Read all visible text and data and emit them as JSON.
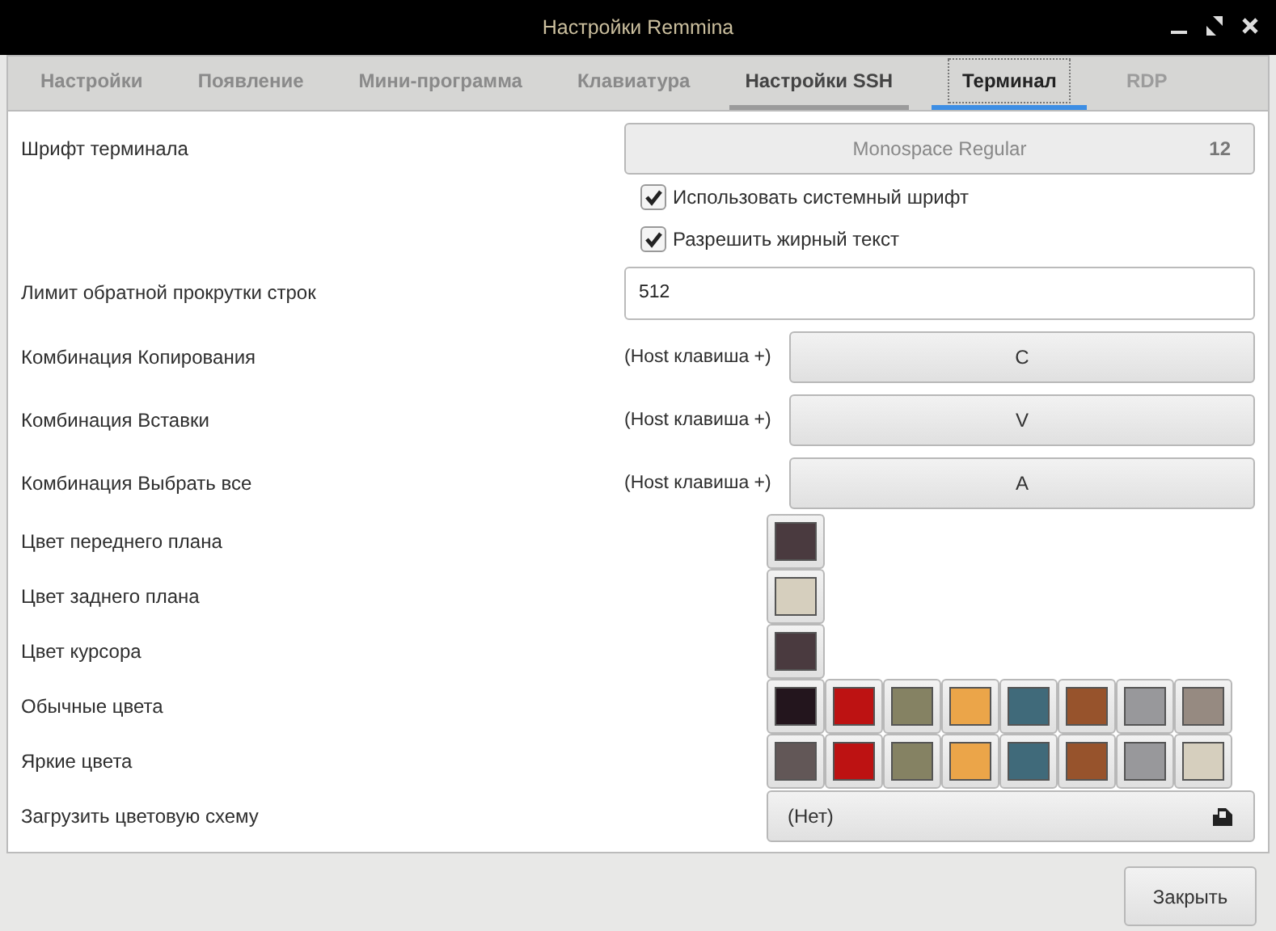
{
  "window": {
    "title": "Настройки Remmina"
  },
  "tabs": [
    {
      "label": "Настройки",
      "selected": false,
      "hovered": false,
      "disabled": false
    },
    {
      "label": "Появление",
      "selected": false,
      "hovered": false,
      "disabled": false
    },
    {
      "label": "Мини-программа",
      "selected": false,
      "hovered": false,
      "disabled": false
    },
    {
      "label": "Клавиатура",
      "selected": false,
      "hovered": false,
      "disabled": false
    },
    {
      "label": "Настройки SSH",
      "selected": false,
      "hovered": true,
      "disabled": false
    },
    {
      "label": "Терминал",
      "selected": true,
      "hovered": false,
      "disabled": false
    },
    {
      "label": "RDP",
      "selected": false,
      "hovered": false,
      "disabled": true
    }
  ],
  "font": {
    "label": "Шрифт терминала",
    "name": "Monospace Regular",
    "size": "12"
  },
  "checkboxes": [
    {
      "label": "Использовать системный шрифт",
      "checked": true
    },
    {
      "label": "Разрешить жирный текст",
      "checked": true
    }
  ],
  "scrollback": {
    "label": "Лимит обратной прокрутки строк",
    "value": "512"
  },
  "shortcuts": [
    {
      "label": "Комбинация Копирования",
      "prefix": "(Host клавиша +)",
      "key": "C"
    },
    {
      "label": "Комбинация Вставки",
      "prefix": "(Host клавиша +)",
      "key": "V"
    },
    {
      "label": "Комбинация Выбрать все",
      "prefix": "(Host клавиша +)",
      "key": "A"
    }
  ],
  "colors": [
    {
      "label": "Цвет переднего плана",
      "color": "#4a3a3f"
    },
    {
      "label": "Цвет заднего плана",
      "color": "#d6cfbe"
    },
    {
      "label": "Цвет курсора",
      "color": "#4a3a3f"
    }
  ],
  "palettes": [
    {
      "label": "Обычные цвета",
      "swatches": [
        {
          "color": "#23151d"
        },
        {
          "color": "#bd1212"
        },
        {
          "color": "#858263"
        },
        {
          "color": "#eba549"
        },
        {
          "color": "#406a7a"
        },
        {
          "color": "#97532c"
        },
        {
          "color": "#98989b"
        },
        {
          "color": "#968a81"
        }
      ]
    },
    {
      "label": "Яркие цвета",
      "swatches": [
        {
          "color": "#625757"
        },
        {
          "color": "#bd1212"
        },
        {
          "color": "#858263"
        },
        {
          "color": "#eba549"
        },
        {
          "color": "#406a7a"
        },
        {
          "color": "#97532c"
        },
        {
          "color": "#98989b"
        },
        {
          "color": "#d6cfbe"
        }
      ]
    }
  ],
  "scheme": {
    "label": "Загрузить цветовую схему",
    "value": "(Нет)"
  },
  "buttons": [
    {
      "label": "Закрыть"
    }
  ]
}
